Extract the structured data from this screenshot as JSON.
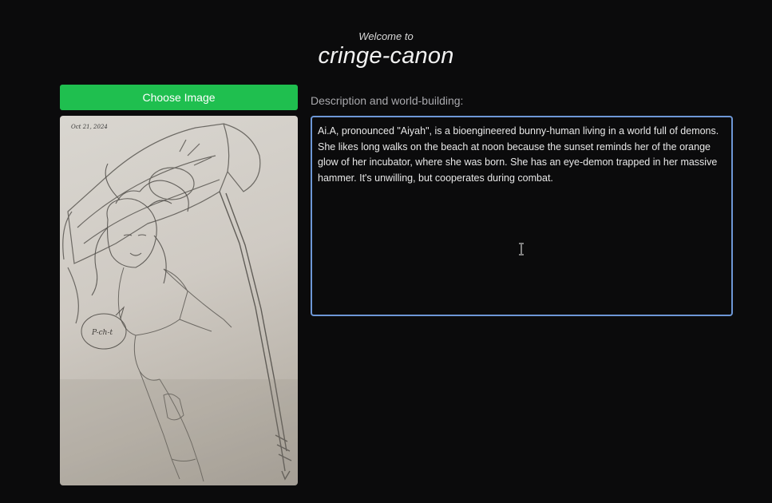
{
  "header": {
    "welcome": "Welcome to",
    "title": "cringe-canon"
  },
  "left_panel": {
    "choose_button_label": "Choose Image",
    "image": {
      "date_text": "Oct 21, 2024",
      "speech_bubble_text": "P-ch-t"
    }
  },
  "right_panel": {
    "label": "Description and world-building:",
    "description": "Ai.A, pronounced \"Aiyah\", is a bioengineered bunny-human living in a world full of demons. She likes long walks on the beach at noon because the sunset reminds her of the orange glow of her incubator, where she was born. She has an eye-demon trapped in her massive hammer. It's unwilling, but cooperates during combat."
  },
  "colors": {
    "background": "#0b0b0c",
    "button_green": "#1fbf4f",
    "focus_border": "#6d97d6"
  },
  "icons": {
    "text_cursor": "i-beam-cursor-icon"
  }
}
